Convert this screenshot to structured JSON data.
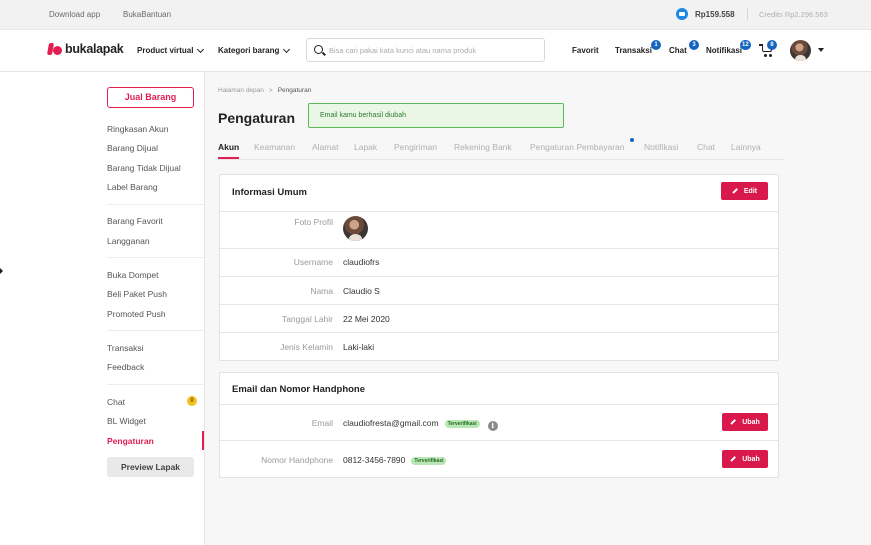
{
  "topbar": {
    "links": [
      "Download app",
      "BukaBantuan"
    ],
    "balance": "Rp159.558",
    "credits": "Credits Rp2.296.563"
  },
  "header": {
    "logo_text": "bukalapak",
    "nav": [
      "Product virtual",
      "Kategori barang"
    ],
    "search_placeholder": "Bisa cari pakai kata kunci atau nama produk",
    "links": {
      "favorit": "Favorit",
      "transaksi": "Transaksi",
      "chat": "Chat",
      "notifikasi": "Notifikasi"
    },
    "badges": {
      "transaksi": "1",
      "chat": "3",
      "notifikasi": "12",
      "cart": "8"
    }
  },
  "sidebar": {
    "jual_button": "Jual Barang",
    "groups": [
      [
        "Ringkasan Akun",
        "Barang Dijual",
        "Barang Tidak Dijual",
        "Label Barang"
      ],
      [
        "Barang Favorit",
        "Langganan"
      ],
      [
        "Buka Dompet",
        "Beli Paket Push",
        "Promoted Push"
      ],
      [
        "Transaksi",
        "Feedback"
      ],
      [
        "Chat",
        "BL Widget",
        "Pengaturan"
      ]
    ],
    "chat_badge": "0",
    "active_item": "Pengaturan",
    "preview_button": "Preview Lapak"
  },
  "main": {
    "breadcrumb": [
      "Halaman depan",
      "Pengaturan"
    ],
    "breadcrumb_sep": ">",
    "title": "Pengaturan",
    "alert": "Email kamu berhasil diubah",
    "tabs": [
      "Akun",
      "Keamanan",
      "Alamat",
      "Lapak",
      "Pengiriman",
      "Rekening Bank",
      "Pengaturan Pembayaran",
      "Notifikasi",
      "Chat",
      "Lainnya"
    ],
    "active_tab": "Akun",
    "info_umum": {
      "title": "Informasi Umum",
      "edit_button": "Edit",
      "rows": [
        {
          "label": "Foto Profil",
          "value": ""
        },
        {
          "label": "Username",
          "value": "claudiofrs"
        },
        {
          "label": "Nama",
          "value": "Claudio S"
        },
        {
          "label": "Tanggal Lahir",
          "value": "22 Mei 2020"
        },
        {
          "label": "Jenis Kelamin",
          "value": "Laki-laki"
        }
      ]
    },
    "email_hp": {
      "title": "Email dan Nomor Handphone",
      "rows": [
        {
          "label": "Email",
          "value": "claudiofresta@gmail.com",
          "badge": "Terverifikasi",
          "button": "Ubah"
        },
        {
          "label": "Nomor Handphone",
          "value": "0812-3456-7890",
          "badge": "Terverifikasi",
          "button": "Ubah"
        }
      ]
    }
  },
  "colors": {
    "brand": "#e31e52",
    "accent_blue": "#1565c0",
    "success_border": "#5cb85c"
  }
}
